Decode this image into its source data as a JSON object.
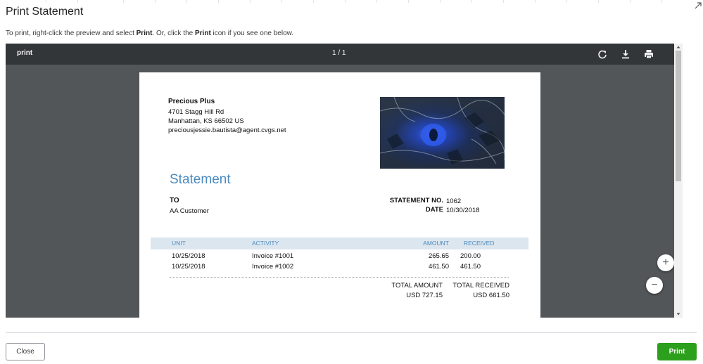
{
  "dialog": {
    "title": "Print Statement",
    "instructions": {
      "part1": "To print, right-click the preview and select ",
      "print_word1": "Print",
      "part2": ". Or, click the ",
      "print_word2": "Print",
      "part3": " icon if you see one below."
    }
  },
  "viewer": {
    "doc_title": "print",
    "page_indicator": "1 / 1",
    "toolbar_icons": [
      "rotate-icon",
      "download-icon",
      "printer-icon"
    ]
  },
  "statement": {
    "company": {
      "name": "Precious Plus",
      "street": "4701 Stagg Hill Rd",
      "city": "Manhattan, KS  66502 US",
      "email": "preciousjessie.bautista@agent.cvgs.net"
    },
    "heading": "Statement",
    "to_label": "TO",
    "to_name": "AA Customer",
    "statement_no_label": "STATEMENT NO.",
    "statement_no": "1062",
    "date_label": "DATE",
    "date": "10/30/2018",
    "table": {
      "headers": [
        "UNIT",
        "ACTIVITY",
        "AMOUNT",
        "RECEIVED"
      ],
      "rows": [
        {
          "unit": "10/25/2018",
          "activity": "Invoice #1001",
          "amount": "265.65",
          "received": "200.00"
        },
        {
          "unit": "10/25/2018",
          "activity": "Invoice #1002",
          "amount": "461.50",
          "received": "461.50"
        }
      ]
    },
    "totals": {
      "total_amount_label": "TOTAL AMOUNT",
      "total_amount": "USD 727.15",
      "total_received_label": "TOTAL RECEIVED",
      "total_received": "USD 661.50"
    }
  },
  "zoom": {
    "in_symbol": "+",
    "out_symbol": "−"
  },
  "footer": {
    "close_label": "Close",
    "print_label": "Print"
  },
  "colors": {
    "accent_green": "#2ca01c",
    "statement_blue": "#4b8bbe",
    "viewer_toolbar": "#323639",
    "viewer_bg": "#525659"
  }
}
